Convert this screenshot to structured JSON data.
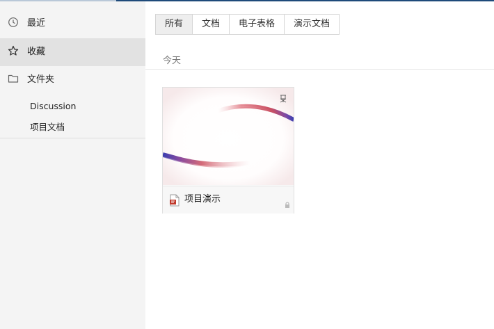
{
  "sidebar": {
    "items": [
      {
        "label": "最近",
        "icon": "clock-icon"
      },
      {
        "label": "收藏",
        "icon": "star-icon"
      },
      {
        "label": "文件夹",
        "icon": "folder-icon"
      }
    ],
    "folders": [
      "Discussion",
      "项目文档"
    ]
  },
  "tabs": [
    "所有",
    "文档",
    "电子表格",
    "演示文档"
  ],
  "active_tab": "所有",
  "section": {
    "label": "今天"
  },
  "files": [
    {
      "title": "项目演示",
      "type": "presentation",
      "icons": [
        "presentation-file-icon",
        "lock-icon",
        "pin-icon"
      ]
    }
  ],
  "colors": {
    "accent": "#1e4a7a",
    "sidebar_bg": "#f4f4f4",
    "active_item": "#e2e2e2"
  }
}
